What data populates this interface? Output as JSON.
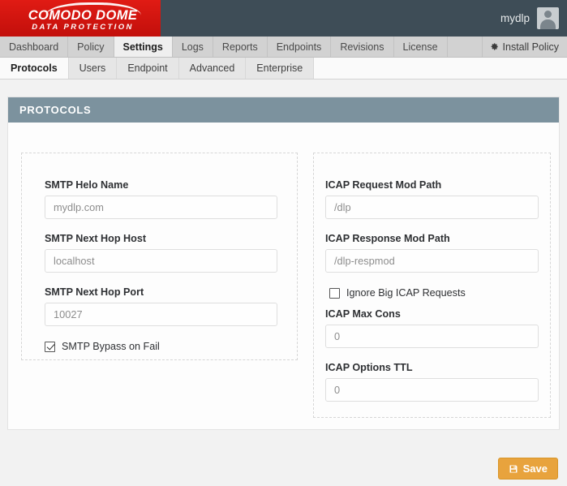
{
  "brand": {
    "line1": "COMODO DOME",
    "line2": "DATA PROTECTION",
    "red": "#d4110d"
  },
  "header": {
    "user_name": "mydlp",
    "avatar_icon": "user-avatar-icon"
  },
  "main_nav": {
    "items": [
      {
        "label": "Dashboard",
        "active": false
      },
      {
        "label": "Policy",
        "active": false
      },
      {
        "label": "Settings",
        "active": true
      },
      {
        "label": "Logs",
        "active": false
      },
      {
        "label": "Reports",
        "active": false
      },
      {
        "label": "Endpoints",
        "active": false
      },
      {
        "label": "Revisions",
        "active": false
      },
      {
        "label": "License",
        "active": false
      }
    ],
    "install_policy": {
      "label": "Install Policy",
      "icon": "gear-icon"
    }
  },
  "sub_nav": {
    "items": [
      {
        "label": "Protocols",
        "active": true
      },
      {
        "label": "Users",
        "active": false
      },
      {
        "label": "Endpoint",
        "active": false
      },
      {
        "label": "Advanced",
        "active": false
      },
      {
        "label": "Enterprise",
        "active": false
      }
    ]
  },
  "panel": {
    "title": "PROTOCOLS",
    "title_bar_color": "#7c929e"
  },
  "smtp": {
    "helo_name": {
      "label": "SMTP Helo Name",
      "value": "mydlp.com"
    },
    "next_hop_host": {
      "label": "SMTP Next Hop Host",
      "value": "localhost"
    },
    "next_hop_port": {
      "label": "SMTP Next Hop Port",
      "value": "10027"
    },
    "bypass_on_fail": {
      "label": "SMTP Bypass on Fail",
      "checked": true
    }
  },
  "icap": {
    "request_mod_path": {
      "label": "ICAP Request Mod Path",
      "value": "/dlp"
    },
    "response_mod_path": {
      "label": "ICAP Response Mod Path",
      "value": "/dlp-respmod"
    },
    "ignore_big_requests": {
      "label": "Ignore Big ICAP Requests",
      "checked": false
    },
    "max_cons": {
      "label": "ICAP Max Cons",
      "value": "0"
    },
    "options_ttl": {
      "label": "ICAP Options TTL",
      "value": "0"
    }
  },
  "footer": {
    "save": {
      "label": "Save",
      "icon": "save-disk-icon",
      "color": "#e8a33d"
    }
  }
}
